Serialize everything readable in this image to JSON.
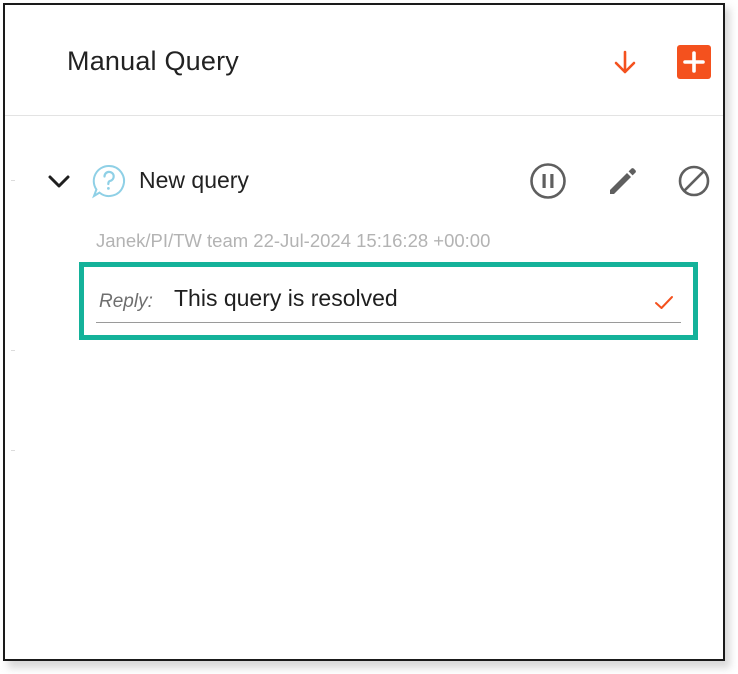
{
  "header": {
    "title": "Manual Query",
    "download_icon": "arrow-down-icon",
    "add_icon": "plus-icon",
    "accent_color": "#f4511e"
  },
  "query": {
    "title": "New query",
    "status_icon": "question-circle-icon",
    "actions": [
      {
        "name": "pause",
        "icon": "pause-circle-icon"
      },
      {
        "name": "edit",
        "icon": "pencil-icon"
      },
      {
        "name": "block",
        "icon": "block-icon"
      }
    ],
    "meta": "Janek/PI/TW team 22-Jul-2024 15:16:28 +00:00",
    "reply": {
      "label": "Reply:",
      "value": "This query is resolved",
      "confirm_icon": "check-icon",
      "highlight_color": "#14b29a"
    }
  }
}
